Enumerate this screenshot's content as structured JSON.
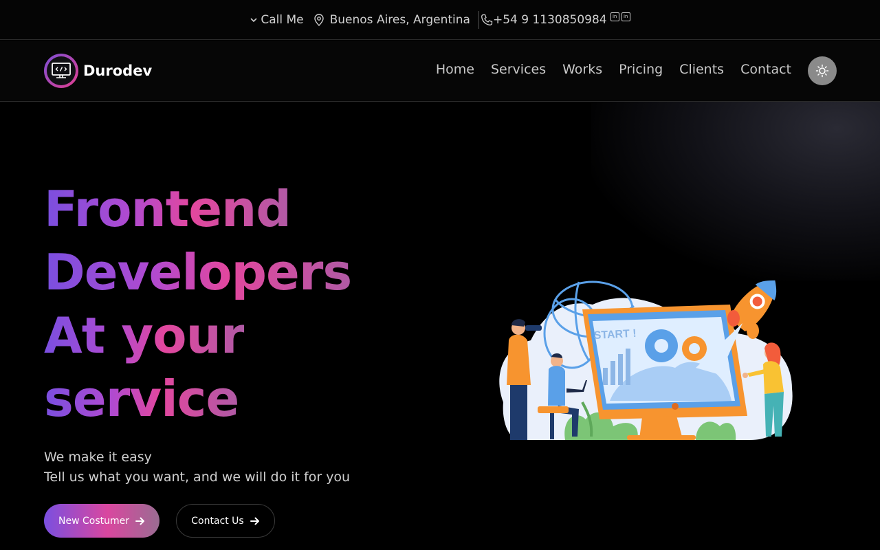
{
  "topbar": {
    "call_label": "Call Me",
    "location": "Buenos Aires, Argentina",
    "phone": "+54 9 1130850984",
    "social": [
      "in",
      "in"
    ]
  },
  "nav": {
    "brand": "Durodev",
    "items": [
      "Home",
      "Services",
      "Works",
      "Pricing",
      "Clients",
      "Contact"
    ]
  },
  "hero": {
    "lines": [
      "Frontend",
      "Developers",
      "At your",
      "service"
    ],
    "subtitle_1": "We make it easy",
    "subtitle_2": "Tell us what you want, and we will do it for you",
    "primary_button": "New Costumer",
    "secondary_button": "Contact Us",
    "screen_text": "START !"
  },
  "colors": {
    "gradient_start": "#7a4fe0",
    "gradient_mid": "#e2479e",
    "background": "#000000"
  }
}
